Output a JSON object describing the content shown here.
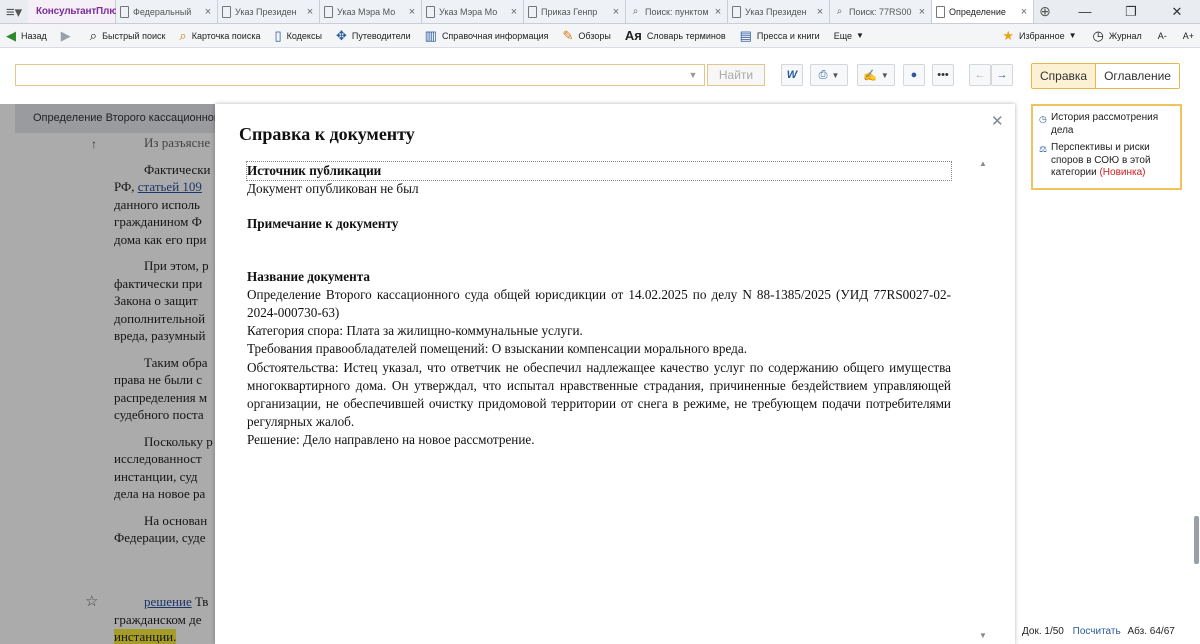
{
  "tabs": {
    "brand": "КонсультантПлюс",
    "items": [
      {
        "label": "Федеральный",
        "icon": "doc-icon"
      },
      {
        "label": "Указ Президен",
        "icon": "doc-icon"
      },
      {
        "label": "Указ Мэра Мо",
        "icon": "doc-icon"
      },
      {
        "label": "Указ Мэра Мо",
        "icon": "doc-icon"
      },
      {
        "label": "Приказ Генпр",
        "icon": "doc-icon"
      },
      {
        "label": "Поиск: пунктом",
        "icon": "search-icon"
      },
      {
        "label": "Указ Президен",
        "icon": "doc-icon"
      },
      {
        "label": "Поиск: 77RS00",
        "icon": "search-icon"
      },
      {
        "label": "Определение",
        "icon": "doc-icon",
        "active": true
      }
    ]
  },
  "toolbar": {
    "back": "Назад",
    "quick_search": "Быстрый поиск",
    "search_card": "Карточка поиска",
    "codes": "Кодексы",
    "guides": "Путеводители",
    "reference": "Справочная информация",
    "reviews": "Обзоры",
    "glossary": "Словарь терминов",
    "press": "Пресса и книги",
    "more": "Еще",
    "favorites": "Избранное",
    "journal": "Журнал",
    "font_size": "A-"
  },
  "search": {
    "value": "",
    "find_label": "Найти"
  },
  "side_tabs": {
    "reference": "Справка",
    "contents": "Оглавление"
  },
  "document": {
    "header": "Определение Второго кассационного суда общей юрисдикции от 14.02.2025 по делу N 88-1385/2025",
    "lines": [
      {
        "text": "Из разъясне",
        "indent": true,
        "grey": true
      },
      {
        "gap": true
      },
      {
        "text": "Фактически",
        "indent": true
      },
      {
        "text": "РФ, ",
        "link": "статьей 109"
      },
      {
        "text": "данного исполь"
      },
      {
        "text": "гражданином Ф"
      },
      {
        "text": "дома как его при"
      },
      {
        "gap": true
      },
      {
        "text": "При этом, р",
        "indent": true
      },
      {
        "text": "фактически при"
      },
      {
        "text": "Закона о защит"
      },
      {
        "text": "дополнительной"
      },
      {
        "text": "вреда, разумный"
      },
      {
        "gap": true
      },
      {
        "text": "Таким обра",
        "indent": true
      },
      {
        "text": "права не были с"
      },
      {
        "text": "распределения м"
      },
      {
        "text": "судебного поста"
      },
      {
        "gap": true
      },
      {
        "text": "Поскольку р",
        "indent": true
      },
      {
        "text": "исследованност"
      },
      {
        "text": "инстанции, суд"
      },
      {
        "text": "дела на новое ра"
      },
      {
        "gap": true
      },
      {
        "text": "На основан",
        "indent": true
      },
      {
        "text": "Федерации, суде"
      }
    ],
    "bottom_lines": [
      {
        "link": "решение",
        "text": " Тв",
        "indent": true
      },
      {
        "text": "гражданском де"
      },
      {
        "highlight": "инстанции."
      }
    ]
  },
  "right_panel": {
    "items": [
      {
        "icon": "history-icon",
        "text": "История рассмотрения дела"
      },
      {
        "icon": "scales-icon",
        "text": "Перспективы и риски споров в СОЮ в этой категории ",
        "badge": "(Новинка)"
      }
    ]
  },
  "status": {
    "doc_label": "Док.",
    "doc_pos": "1/50",
    "count_link": "Посчитать",
    "par_label": "Абз.",
    "par_pos": "64/67"
  },
  "modal": {
    "title": "Справка к документу",
    "source_heading": "Источник публикации",
    "source_text": "Документ опубликован не был",
    "note_heading": "Примечание к документу",
    "name_heading": "Название документа",
    "name_text": "Определение Второго кассационного суда общей юрисдикции от 14.02.2025 по делу N 88-1385/2025 (УИД 77RS0027-02-2024-000730-63)",
    "category": "Категория спора: Плата за жилищно-коммунальные услуги.",
    "claims": "Требования правообладателей помещений: О взыскании компенсации морального вреда.",
    "circumstances": "Обстоятельства: Истец указал, что ответчик не обеспечил надлежащее качество услуг по содержанию общего имущества многоквартирного дома. Он утверждал, что испытал нравственные страдания, причиненные бездействием управляющей организации, не обеспечившей очистку придомовой территории от снега в режиме, не требующем подачи потребителями регулярных жалоб.",
    "decision": "Решение: Дело направлено на новое рассмотрение."
  }
}
